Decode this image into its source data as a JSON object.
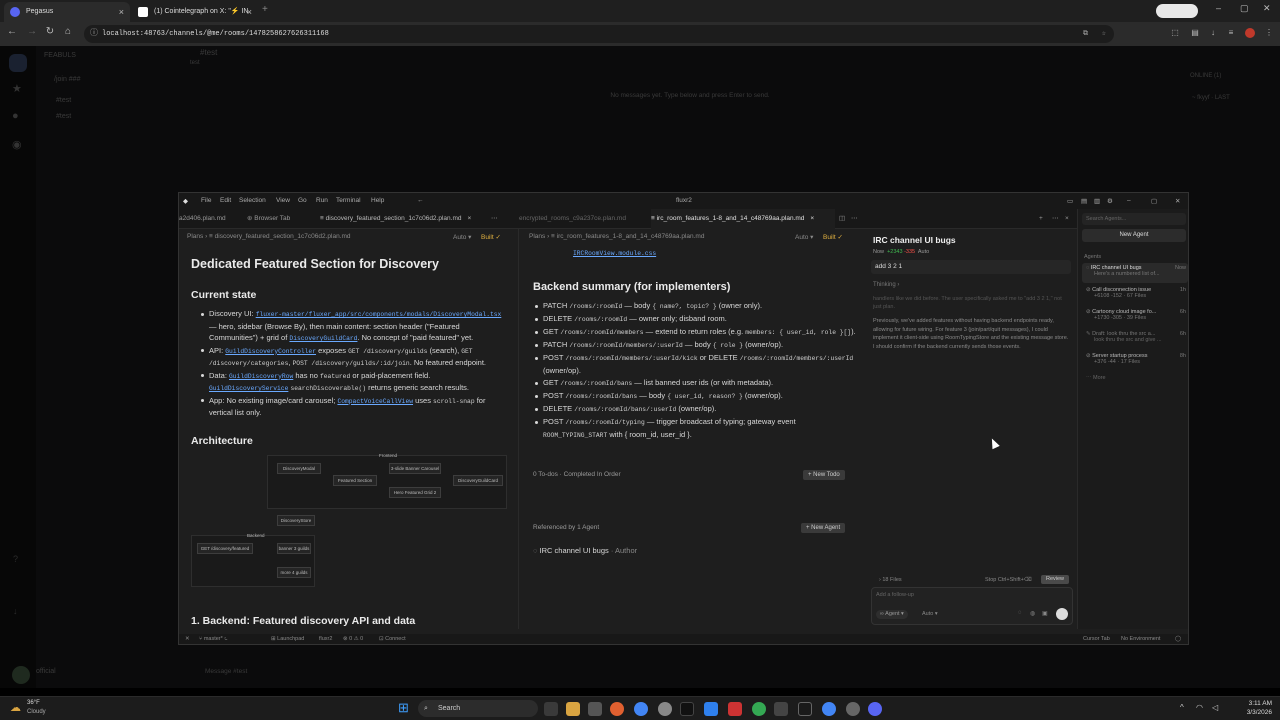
{
  "browser": {
    "tabs": [
      {
        "title": "Pegasus",
        "active": true
      },
      {
        "title": "(1) Cointelegraph on X: \"⚡ IN",
        "active": false
      }
    ],
    "url": "localhost:48763/channels/@me/rooms/1478258627626311168"
  },
  "background_app": {
    "server_label": "FEABULS",
    "channel_title": "#test",
    "channel_sub": "test",
    "join_hint": "/join ###",
    "rooms": [
      "#test",
      "#test"
    ],
    "empty_text": "No messages yet. Type below and press Enter to send.",
    "online": "ONLINE (1)",
    "right_hint": "~ fkyyf · LAST",
    "user": "official",
    "composer_placeholder": "Message #test"
  },
  "editor": {
    "menu": [
      "File",
      "Edit",
      "Selection",
      "View",
      "Go",
      "Run",
      "Terminal",
      "Help"
    ],
    "window_title": "fluxr2",
    "tabs": [
      "a2d406.plan.md",
      "Browser Tab",
      "discovery_featured_section_1c7c06d2.plan.md",
      "encrypted_rooms_c9a237ce.plan.md",
      "irc_room_features_1-8_and_14_c48769aa.plan.md"
    ],
    "left_pane": {
      "crumb_root": "Plans",
      "crumb_file": "discovery_featured_section_1c7c06d2.plan.md",
      "mode": "Auto",
      "status": "Built",
      "title": "Dedicated Featured Section for Discovery",
      "h_current": "Current state",
      "bullets": [
        {
          "k": "Discovery UI:",
          "link": "fluxer-master/fluxer_app/src/components/modals/DiscoveryModal.tsx",
          "t": "— hero, sidebar (Browse By), then main content: section header (\"Featured Communities\") + grid of",
          "link2": "DiscoveryGuildCard",
          "t2": ". No concept of \"paid featured\" yet."
        },
        {
          "k": "API:",
          "link": "GuildDiscoveryController",
          "t": "exposes",
          "code": "GET /discovery/guilds",
          "t2": "(search),",
          "code2": "GET /discovery/categories",
          "code3": "POST /discovery/guilds/:id/join",
          "t3": ". No featured endpoint."
        },
        {
          "k": "Data:",
          "link": "GuildDiscoveryRow",
          "t": "has no",
          "code": "featured",
          "t2": "or paid-placement field.",
          "link2": "GuildDiscoveryService",
          "code2": "searchDiscoverable()",
          "t3": "returns generic search results."
        },
        {
          "k": "App:",
          "t": "No existing image/card carousel;",
          "link": "CompactVoiceCallView",
          "t2": "uses",
          "code": "scroll-snap",
          "t3": "for vertical list only."
        }
      ],
      "h_arch": "Architecture",
      "diagram": {
        "frontend": "Frontend",
        "backend": "Backend",
        "nodes": [
          "DiscoveryModal",
          "Featured Section",
          "3-slide Banner Carousel",
          "Hero Featured Grid 2",
          "DiscoveryGuildCard",
          "DiscoveryStore",
          "GET /discovery/featured",
          "banner 3 guilds",
          "more 4 guilds"
        ]
      },
      "h_backend": "1. Backend: Featured discovery API and data"
    },
    "mid_pane": {
      "crumb_root": "Plans",
      "crumb_file": "irc_room_features_1-8_and_14_c48769aa.plan.md",
      "mode": "Auto",
      "status": "Built",
      "top_link": "IRCRoomView.module.css",
      "title": "Backend summary (for implementers)",
      "endpoints": [
        {
          "m": "PATCH",
          "p": "/rooms/:roomId",
          "d": "— body",
          "c": "{ name?, topic? }",
          "e": "(owner only)."
        },
        {
          "m": "DELETE",
          "p": "/rooms/:roomId",
          "d": "— owner only; disband room.",
          "c": "",
          "e": ""
        },
        {
          "m": "GET",
          "p": "/rooms/:roomId/members",
          "d": "— extend to return roles (e.g.",
          "c": "members: { user_id, role }[]",
          "e": ")."
        },
        {
          "m": "PATCH",
          "p": "/rooms/:roomId/members/:userId",
          "d": "— body",
          "c": "{ role }",
          "e": "(owner/op)."
        },
        {
          "m": "POST",
          "p": "/rooms/:roomId/members/:userId/kick",
          "d": "or DELETE",
          "c": "/rooms/:roomId/members/:userId",
          "e": "(owner/op)."
        },
        {
          "m": "GET",
          "p": "/rooms/:roomId/bans",
          "d": "— list banned user ids (or with metadata).",
          "c": "",
          "e": ""
        },
        {
          "m": "POST",
          "p": "/rooms/:roomId/bans",
          "d": "— body",
          "c": "{ user_id, reason? }",
          "e": "(owner/op)."
        },
        {
          "m": "DELETE",
          "p": "/rooms/:roomId/bans/:userId",
          "d": "(owner/op).",
          "c": "",
          "e": ""
        },
        {
          "m": "POST",
          "p": "/rooms/:roomId/typing",
          "d": "— trigger broadcast of typing; gateway event",
          "c": "ROOM_TYPING_START",
          "e": "with { room_id, user_id }."
        }
      ],
      "todos": "0 To-dos · Completed In Order",
      "new_todo": "+ New Todo",
      "referenced": "Referenced by 1 Agent",
      "new_agent": "+ New Agent",
      "agent_ref": "IRC channel UI bugs",
      "agent_ref_role": "· Author"
    },
    "chat": {
      "title": "IRC channel UI bugs",
      "meta_now": "Now",
      "meta_add": "+2343",
      "meta_del": "-335",
      "meta_mode": "Auto",
      "user_msg": "add 3 2 1",
      "thinking": "Thinking",
      "para1": "handlers like we did before. The user specifically asked me to \"add 3 2 1,\" not just plan.",
      "para2": "Previously, we've added features without having backend endpoints ready, allowing for future wiring. For feature 3 (join/part/quit messages), I could implement it client-side using RoomTypingStore and the existing message store. I should confirm if the backend currently sends those events.",
      "files": "18 Files",
      "stop": "Stop Ctrl+Shift+⌫",
      "review": "Review",
      "placeholder": "Add a follow-up",
      "agent_mode": "Agent",
      "auto": "Auto"
    },
    "agents_panel": {
      "search": "Search Agents...",
      "new_agent": "New Agent",
      "section": "Agents",
      "items": [
        {
          "title": "IRC channel UI bugs",
          "sub": "Here's a numbered list of...",
          "time": "Now"
        },
        {
          "title": "Call disconnection issue",
          "sub": "+6108 -152 · 67 Files",
          "time": "1h"
        },
        {
          "title": "Cartoony cloud image fo...",
          "sub": "+1730 -305 · 39 Files",
          "time": "6h"
        },
        {
          "title": "Draft: look thru the src a...",
          "sub": "look thru the src and give ...",
          "time": "6h"
        },
        {
          "title": "Server startup process",
          "sub": "+376 -44 · 17 Files",
          "time": "8h"
        }
      ],
      "more": "More"
    },
    "statusbar": {
      "branch": "master*",
      "launchpad": "Launchpad",
      "workspace": "fluxr2",
      "problems": "⊗ 0 ⚠ 0",
      "connect": "Connect",
      "cursor_tab": "Cursor Tab",
      "env": "No Environment"
    }
  },
  "taskbar": {
    "weather_temp": "36°F",
    "weather_text": "Cloudy",
    "search": "Search",
    "time": "3:11 AM",
    "date": "3/3/2026"
  },
  "colors": {
    "accent": "#0078d4",
    "link": "#6aa9ff",
    "add": "#3fb950",
    "del": "#f85149"
  }
}
